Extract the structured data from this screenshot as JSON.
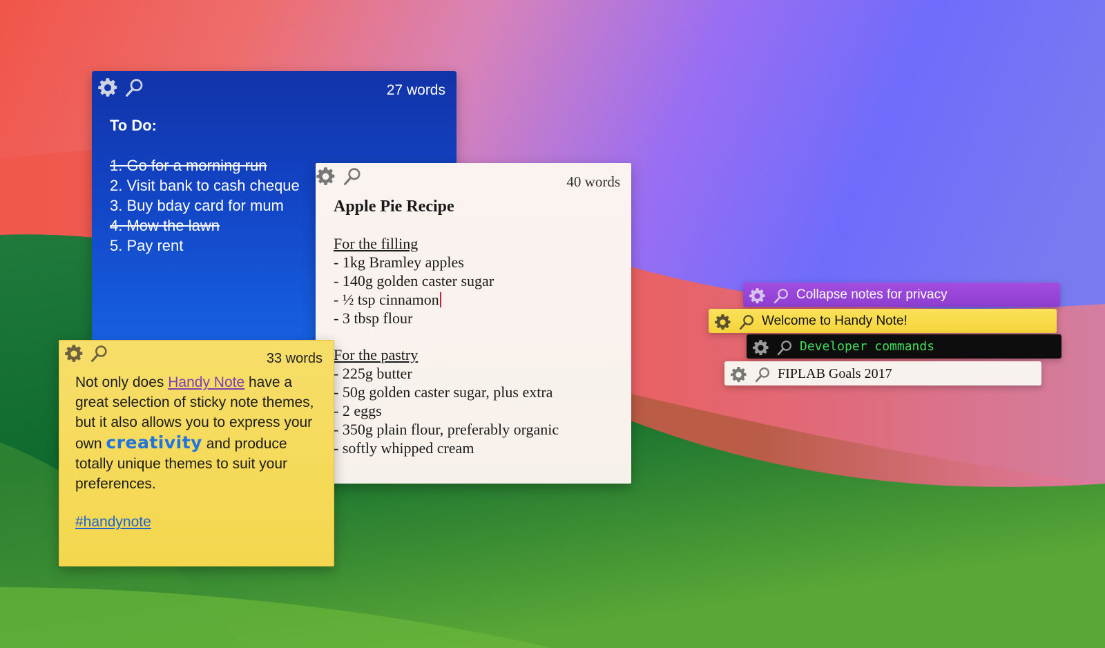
{
  "desktop": {
    "wallpaper": "macOS Sonoma"
  },
  "notes": [
    {
      "theme_color": "#1240b8",
      "word_count": "27 words",
      "title": "To Do:",
      "lines": [
        {
          "text": "1. Go for a morning run",
          "done": true
        },
        {
          "text": "2. Visit bank to cash cheque",
          "done": false
        },
        {
          "text": "3. Buy bday card for mum",
          "done": false
        },
        {
          "text": "4. Mow the lawn",
          "done": true
        },
        {
          "text": "5. Pay rent",
          "done": false
        }
      ]
    },
    {
      "theme_color": "#f8f1ed",
      "word_count": "40 words",
      "title": "Apple Pie Recipe",
      "filling_heading": "For the filling",
      "filling": [
        "- 1kg Bramley apples",
        "- 140g golden caster sugar",
        "- ½ tsp cinnamon",
        "- 3 tbsp flour"
      ],
      "pastry_heading": "For the pastry",
      "pastry": [
        "- 225g butter",
        "- 50g golden caster sugar, plus extra",
        "- 2 eggs",
        "- 350g plain flour, preferably organic",
        "- softly whipped cream"
      ]
    },
    {
      "theme_color": "#f5d850",
      "word_count": "33 words",
      "text_1": "Not only does ",
      "link": "Handy Note",
      "text_2": " have a great selection of sticky note themes, but it also allows you to express your own ",
      "highlight": "creativity",
      "text_3": " and produce totally unique themes to suit your preferences.",
      "hashtag": "#handynote"
    }
  ],
  "collapsed_notes": [
    {
      "title": "Collapse notes for privacy",
      "color": "#9a48db"
    },
    {
      "title": "Welcome to Handy Note!",
      "color": "#f8dc4c"
    },
    {
      "title": "Developer commands",
      "color": "#0d0d0d",
      "text_color": "#3ee05a"
    },
    {
      "title": "FIPLAB Goals 2017",
      "color": "#f8f2ee"
    }
  ],
  "icons": {
    "settings": "gear-icon",
    "search": "search-icon"
  }
}
